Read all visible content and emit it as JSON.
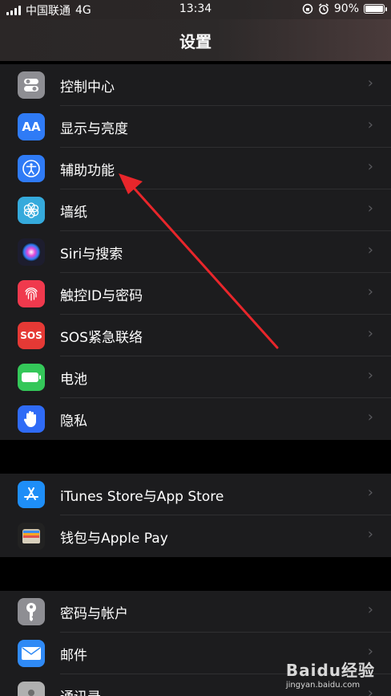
{
  "status_bar": {
    "carrier": "中国联通",
    "network": "4G",
    "time": "13:34",
    "battery_percent": "90%",
    "battery_level": 0.9
  },
  "header": {
    "title": "设置"
  },
  "groups": [
    {
      "items": [
        {
          "label": "控制中心",
          "icon": "control-center-icon",
          "color": "#8e8e93"
        },
        {
          "label": "显示与亮度",
          "icon": "display-brightness-icon",
          "color": "#2f7bf6"
        },
        {
          "label": "辅助功能",
          "icon": "accessibility-icon",
          "color": "#2f7bf6"
        },
        {
          "label": "墙纸",
          "icon": "wallpaper-icon",
          "color": "#35aadc"
        },
        {
          "label": "Siri与搜索",
          "icon": "siri-icon",
          "color": "#1d1d2e"
        },
        {
          "label": "触控ID与密码",
          "icon": "touch-id-icon",
          "color": "#f0394d"
        },
        {
          "label": "SOS紧急联络",
          "icon": "sos-icon",
          "color": "#e53935",
          "icon_text": "SOS"
        },
        {
          "label": "电池",
          "icon": "battery-icon",
          "color": "#34c759"
        },
        {
          "label": "隐私",
          "icon": "privacy-hand-icon",
          "color": "#2f6bf6"
        }
      ]
    },
    {
      "items": [
        {
          "label": "iTunes Store与App Store",
          "icon": "app-store-icon",
          "color": "#1e8ef7"
        },
        {
          "label": "钱包与Apple Pay",
          "icon": "wallet-icon",
          "color": "#222222"
        }
      ]
    },
    {
      "items": [
        {
          "label": "密码与帐户",
          "icon": "key-icon",
          "color": "#8e8e93"
        },
        {
          "label": "邮件",
          "icon": "mail-icon",
          "color": "#2f8af6"
        },
        {
          "label": "通讯录",
          "icon": "contacts-icon",
          "color": "#b0b0b0"
        }
      ]
    }
  ],
  "watermark": {
    "brand": "Baidu经验",
    "site": "jingyan.baidu.com"
  }
}
